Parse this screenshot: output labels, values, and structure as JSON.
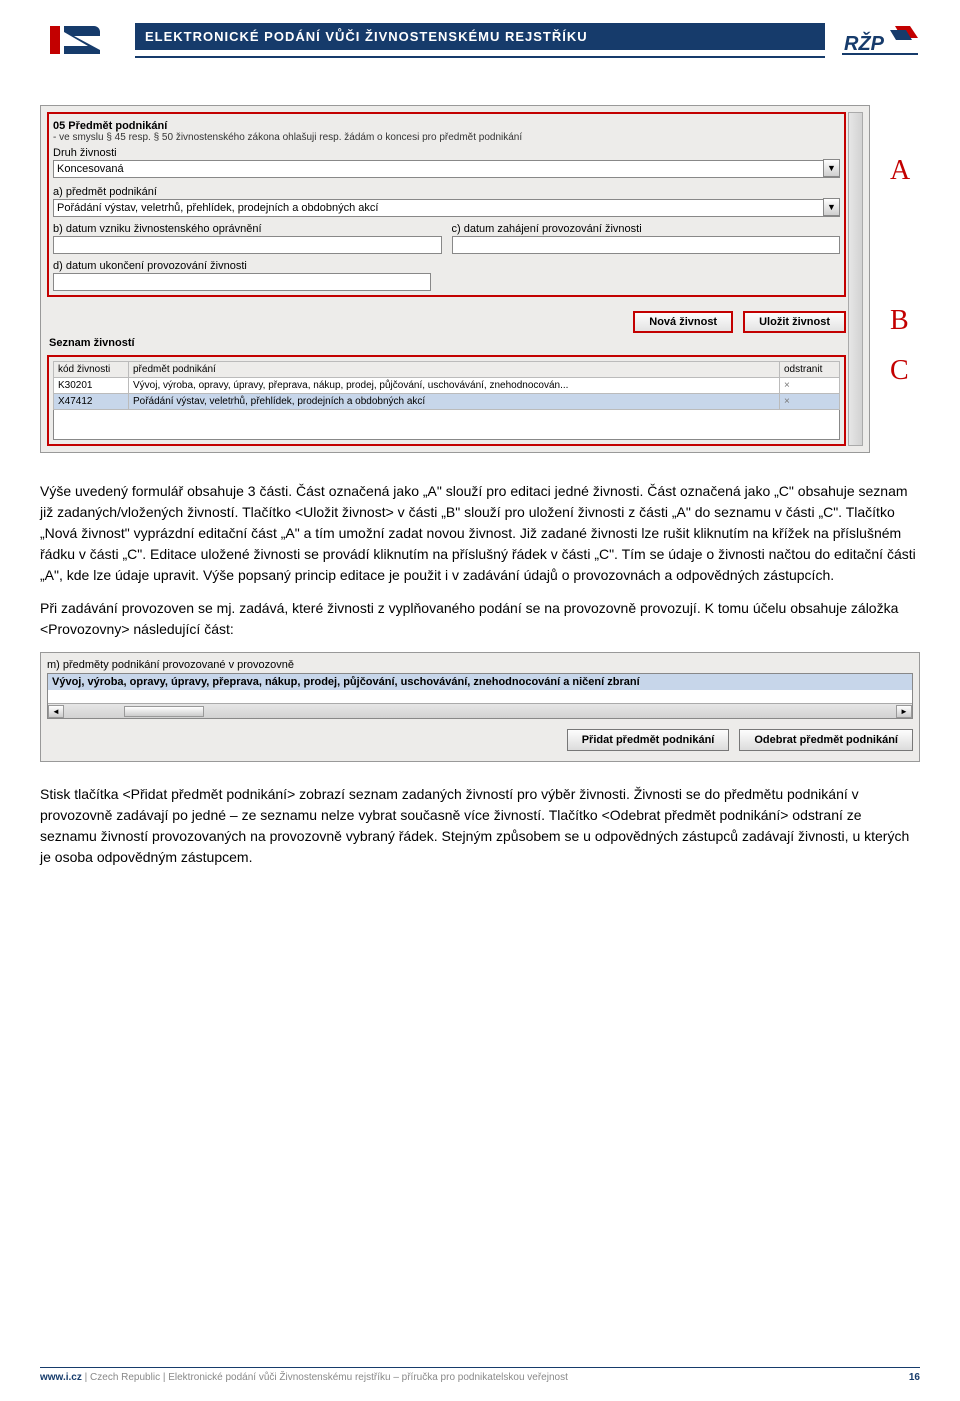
{
  "header": {
    "title": "ELEKTRONICKÉ PODÁNÍ VŮČI ŽIVNOSTENSKÉMU REJSTŘÍKU"
  },
  "form1": {
    "section_title": "05 Předmět podnikání",
    "section_sub": "- ve smyslu § 45 resp. § 50 živnostenského zákona ohlašuji resp. žádám o koncesi pro předmět podnikání",
    "druh_label": "Druh živnosti",
    "druh_value": "Koncesovaná",
    "a_label": "a) předmět podnikání",
    "a_value": "Pořádání výstav, veletrhů, přehlídek, prodejních a obdobných akcí",
    "b_label": "b) datum vzniku živnostenského oprávnění",
    "c_label": "c) datum zahájení provozování živnosti",
    "d_label": "d) datum ukončení provozování živnosti",
    "btn_new": "Nová živnost",
    "btn_save": "Uložit živnost",
    "seznam_title": "Seznam živností",
    "cols": {
      "kod": "kód živnosti",
      "predmet": "předmět podnikání",
      "odstranit": "odstranit"
    },
    "rows": [
      {
        "kod": "K30201",
        "predmet": "Vývoj, výroba, opravy, úpravy, přeprava, nákup, prodej, půjčování, uschovávání, znehodnocován...",
        "del": "×"
      },
      {
        "kod": "X47412",
        "predmet": "Pořádání výstav, veletrhů, přehlídek, prodejních a obdobných akcí",
        "del": "×"
      }
    ]
  },
  "abc": {
    "a": "A",
    "b": "B",
    "c": "C"
  },
  "para1": "Výše uvedený formulář obsahuje 3 části. Část označená jako „A\" slouží pro editaci jedné živnosti. Část označená jako „C\" obsahuje seznam již zadaných/vložených živností. Tlačítko <Uložit živnost> v části „B\" slouží pro uložení živnosti z části „A\" do seznamu v části „C\". Tlačítko „Nová živnost\" vyprázdní editační část „A\" a tím umožní zadat novou živnost. Již zadané živnosti lze rušit kliknutím na křížek na příslušném řádku v části „C\". Editace uložené živnosti se provádí kliknutím na příslušný řádek v části „C\". Tím se údaje o živnosti načtou do editační části „A\", kde lze údaje upravit. Výše popsaný princip editace je použit i v zadávání údajů o provozovnách a odpovědných zástupcích.",
  "para2": "Při zadávání provozoven se mj. zadává, které živnosti z vyplňovaného podání se na provozovně provozují. K tomu účelu obsahuje záložka <Provozovny> následující část:",
  "provozovny": {
    "label": "m) předměty podnikání provozované v provozovně",
    "item": "Vývoj, výroba, opravy, úpravy, přeprava, nákup, prodej, půjčování, uschovávání, znehodnocování a ničení zbraní",
    "btn_add": "Přidat předmět podnikání",
    "btn_remove": "Odebrat předmět podnikání"
  },
  "para3": "Stisk tlačítka <Přidat předmět podnikání> zobrazí seznam zadaných živností pro výběr živnosti. Živnosti se do předmětu podnikání v provozovně zadávají po jedné – ze seznamu nelze vybrat současně více živností. Tlačítko <Odebrat předmět podnikání> odstraní ze seznamu živností provozovaných na provozovně vybraný řádek. Stejným způsobem se u odpovědných zástupců zadávají živnosti, u kterých je osoba odpovědným zástupcem.",
  "footer": {
    "left_bold": "www.i.cz",
    "left_rest": " | Czech Republic | Elektronické podání vůči Živnostenskému rejstříku – příručka pro podnikatelskou veřejnost",
    "page": "16"
  }
}
